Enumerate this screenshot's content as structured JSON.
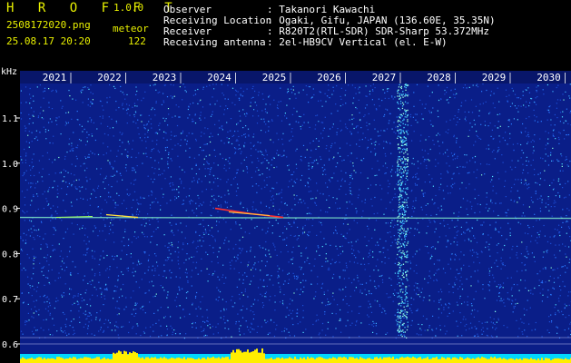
{
  "app": {
    "name": "H R O F F T",
    "version": "1.0.0"
  },
  "file": {
    "name": "2508172020.png",
    "datetime": "25.08.17 20:20"
  },
  "meteor": {
    "label": "meteor",
    "count": "122"
  },
  "info": [
    {
      "key": "Observer",
      "value": ": Takanori Kawachi"
    },
    {
      "key": "Receiving Location",
      "value": ": Ogaki, Gifu, JAPAN (136.60E, 35.35N)"
    },
    {
      "key": "Receiver",
      "value": ": R820T2(RTL-SDR) SDR-Sharp 53.372MHz"
    },
    {
      "key": "Receiving antenna",
      "value": ": 2el-HB9CV Vertical (el. E-W)"
    }
  ],
  "axis": {
    "unit": "kHz",
    "y_ticks": [
      "1.1",
      "1.0",
      "0.9",
      "0.8",
      "0.7",
      "0.6"
    ],
    "x_ticks": [
      "2021",
      "2022",
      "2023",
      "2024",
      "2025",
      "2026",
      "2027",
      "2028",
      "2029",
      "2030"
    ]
  },
  "colors": {
    "header_text": "#e8f000",
    "info_text": "#ffffff",
    "background": "#0a1e88",
    "meteor_line": "#ff3030"
  },
  "spectrogram": {
    "carrier_khz": 0.88
  }
}
